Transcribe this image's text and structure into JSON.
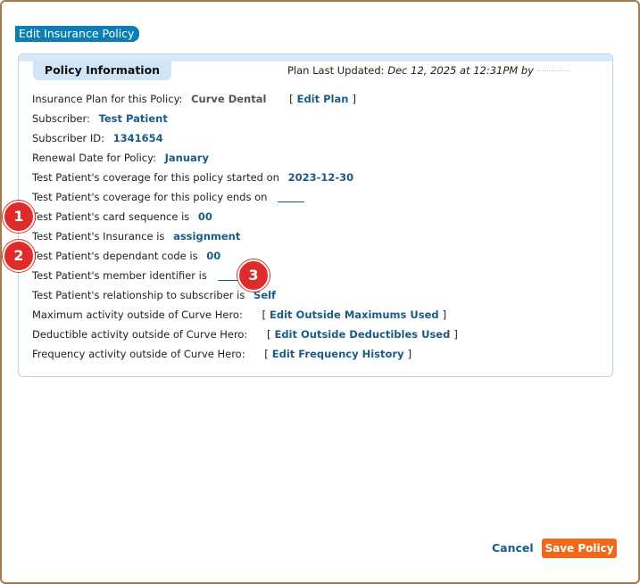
{
  "dialog": {
    "title": "Edit Insurance Policy"
  },
  "panel": {
    "tab_label": "Policy Information",
    "updated_prefix": "Plan Last Updated:",
    "updated_date": "Dec 12, 2025 at 12:31PM by"
  },
  "rows": {
    "plan": {
      "label": "Insurance Plan for this Policy:",
      "value": "Curve Dental",
      "link": "Edit Plan"
    },
    "subscriber": {
      "label": "Subscriber:",
      "value": "Test Patient"
    },
    "subscriber_id": {
      "label": "Subscriber ID:",
      "value": "1341654"
    },
    "renewal": {
      "label": "Renewal Date for Policy:",
      "value": "January"
    },
    "coverage_start": {
      "label": "Test Patient's coverage for this policy started on",
      "value": "2023-12-30"
    },
    "coverage_end": {
      "label": "Test Patient's coverage for this policy ends on"
    },
    "card_sequence": {
      "label": "Test Patient's card sequence is",
      "value": "00"
    },
    "insurance": {
      "label": "Test Patient's Insurance is",
      "value": "assignment"
    },
    "dependant_code": {
      "label": "Test Patient's dependant code is",
      "value": "00"
    },
    "member_id": {
      "label": "Test Patient's member identifier is"
    },
    "relationship": {
      "label": "Test Patient's relationship to subscriber is",
      "value": "Self"
    },
    "maximum": {
      "label": "Maximum activity outside of Curve Hero:",
      "link": "Edit Outside Maximums Used"
    },
    "deductible": {
      "label": "Deductible activity outside of Curve Hero:",
      "link": "Edit Outside Deductibles Used"
    },
    "frequency": {
      "label": "Frequency activity outside of Curve Hero:",
      "link": "Edit Frequency History"
    }
  },
  "markers": [
    "1",
    "2",
    "3"
  ],
  "footer": {
    "cancel_label": "Cancel",
    "save_label": "Save Policy"
  },
  "colors": {
    "title_bg": "#0b7fb3",
    "link": "#1a5c86",
    "save_bg": "#ee6a1a",
    "marker": "#e02b2b",
    "frame": "#a77a4e"
  }
}
